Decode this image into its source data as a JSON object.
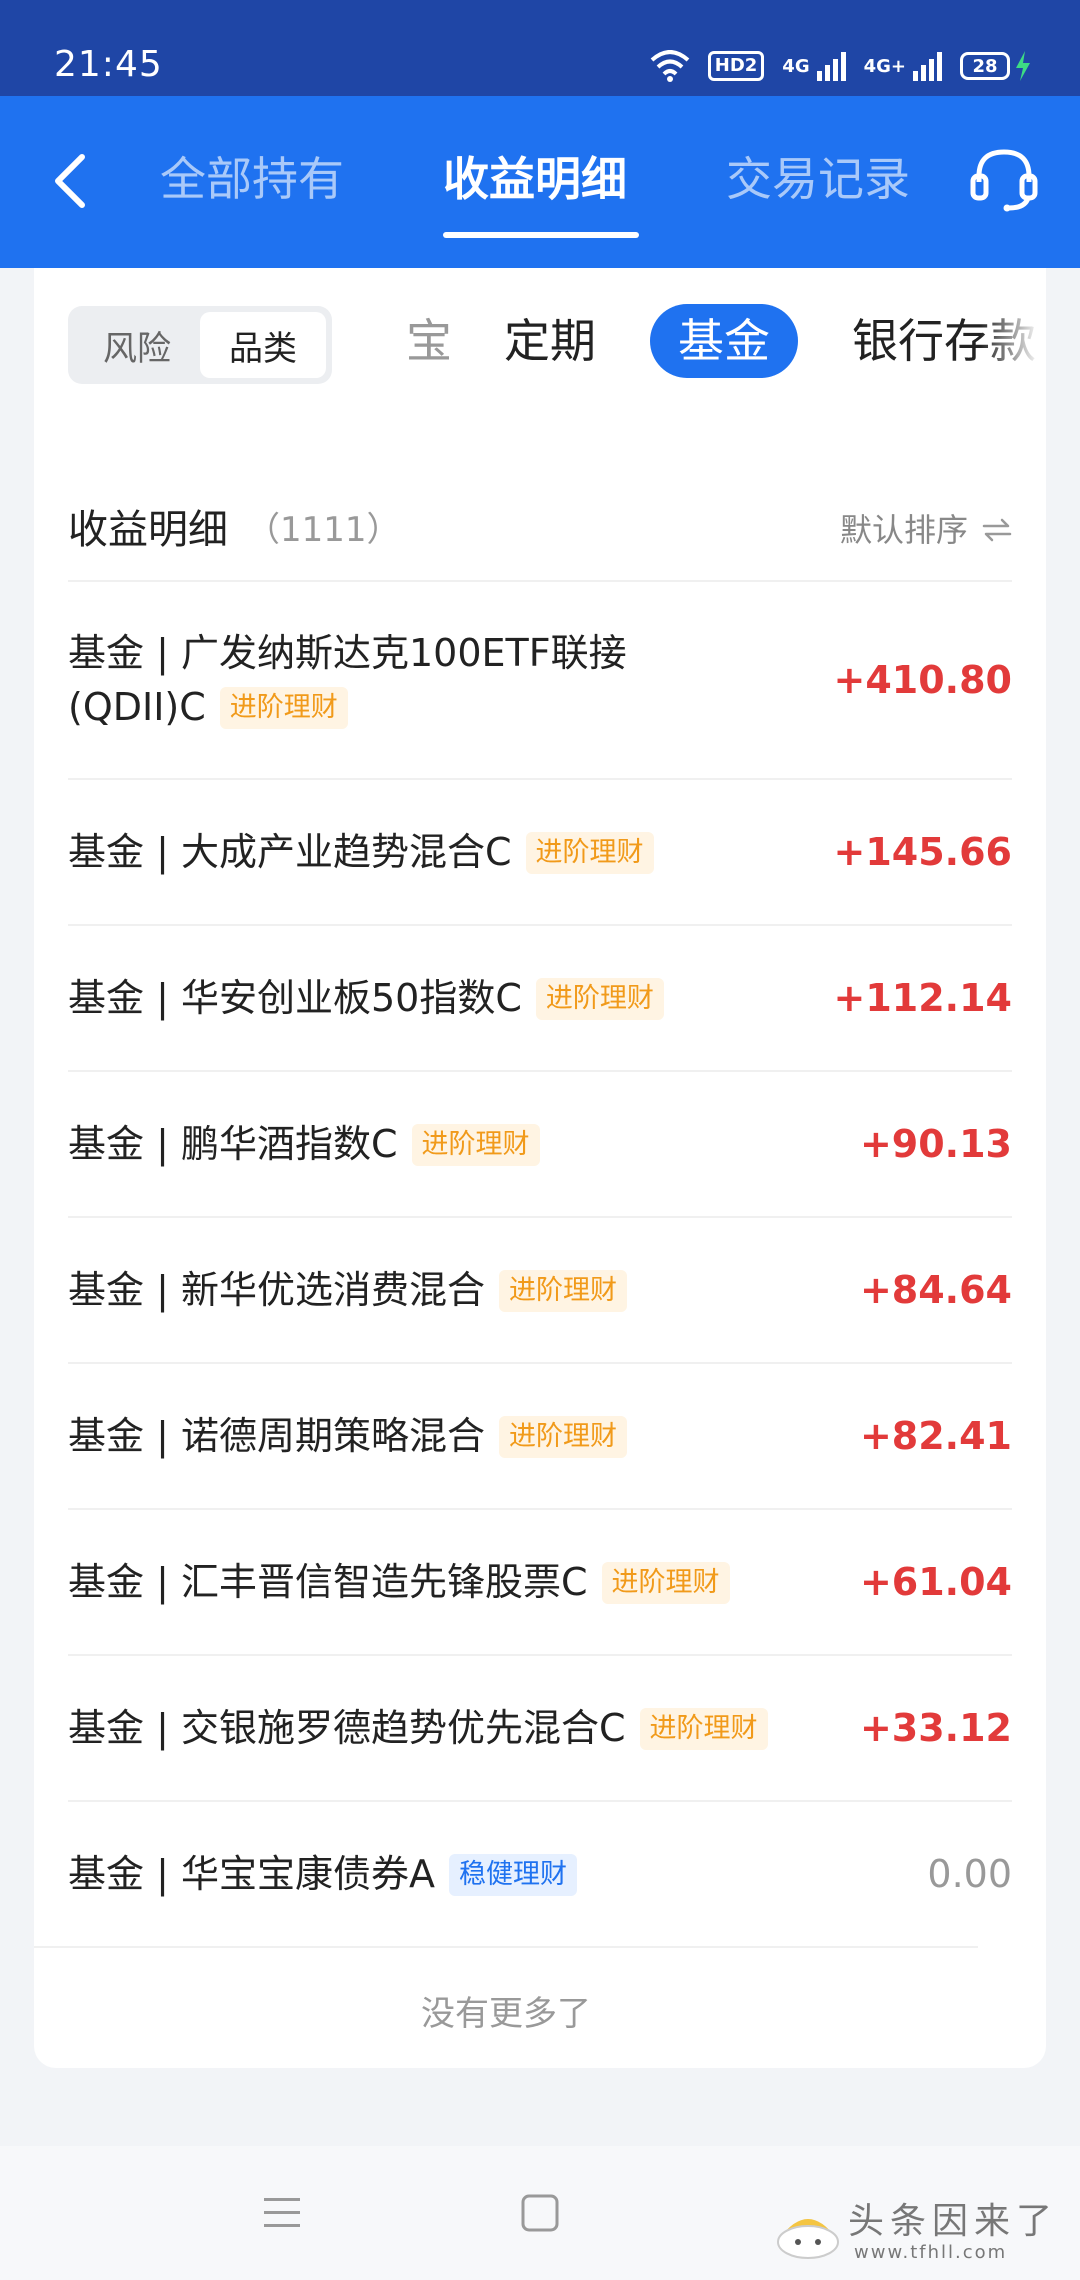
{
  "status_bar": {
    "time": "21:45",
    "hd_label": "HD2",
    "net1_label": "4G",
    "net2_label": "4G+",
    "battery_level": "28"
  },
  "header": {
    "tabs": [
      {
        "label": "全部持有",
        "active": false
      },
      {
        "label": "收益明细",
        "active": true
      },
      {
        "label": "交易记录",
        "active": false
      }
    ]
  },
  "filters": {
    "segments": [
      {
        "label": "风险",
        "active": false
      },
      {
        "label": "品类",
        "active": true
      }
    ],
    "categories": [
      {
        "label": "宝",
        "state": "faded"
      },
      {
        "label": "定期",
        "state": "normal"
      },
      {
        "label": "基金",
        "state": "active"
      },
      {
        "label": "银行存款",
        "state": "normal"
      }
    ]
  },
  "list": {
    "title": "收益明细",
    "count": "（1111）",
    "sort_label": "默认排序",
    "rows": [
      {
        "name": "基金 | 广发纳斯达克100ETF联接(QDII)C",
        "tag": "进阶理财",
        "value": "+410.80"
      },
      {
        "name": "基金 | 大成产业趋势混合C",
        "tag": "进阶理财",
        "value": "+145.66"
      },
      {
        "name": "基金 | 华安创业板50指数C",
        "tag": "进阶理财",
        "value": "+112.14"
      },
      {
        "name": "基金 | 鹏华酒指数C",
        "tag": "进阶理财",
        "value": "+90.13"
      },
      {
        "name": "基金 | 新华优选消费混合",
        "tag": "进阶理财",
        "value": "+84.64"
      },
      {
        "name": "基金 | 诺德周期策略混合",
        "tag": "进阶理财",
        "value": "+82.41"
      },
      {
        "name": "基金 | 汇丰晋信智造先锋股票C",
        "tag": "进阶理财",
        "value": "+61.04"
      },
      {
        "name": "基金 | 交银施罗德趋势优先混合C",
        "tag": "进阶理财",
        "value": "+33.12"
      },
      {
        "name": "基金 | 华宝宝康债券A",
        "tag": "稳健理财",
        "value": "0.00"
      }
    ],
    "end_text": "没有更多了"
  },
  "watermark": {
    "text": "头条因来了",
    "url": "www.tfhll.com"
  },
  "colors": {
    "header_blue": "#1f72f0",
    "status_blue": "#1f46a6",
    "gain_red": "#e23a3a",
    "advanced_tag": "#f19a1a",
    "stable_tag": "#1f72f0"
  }
}
